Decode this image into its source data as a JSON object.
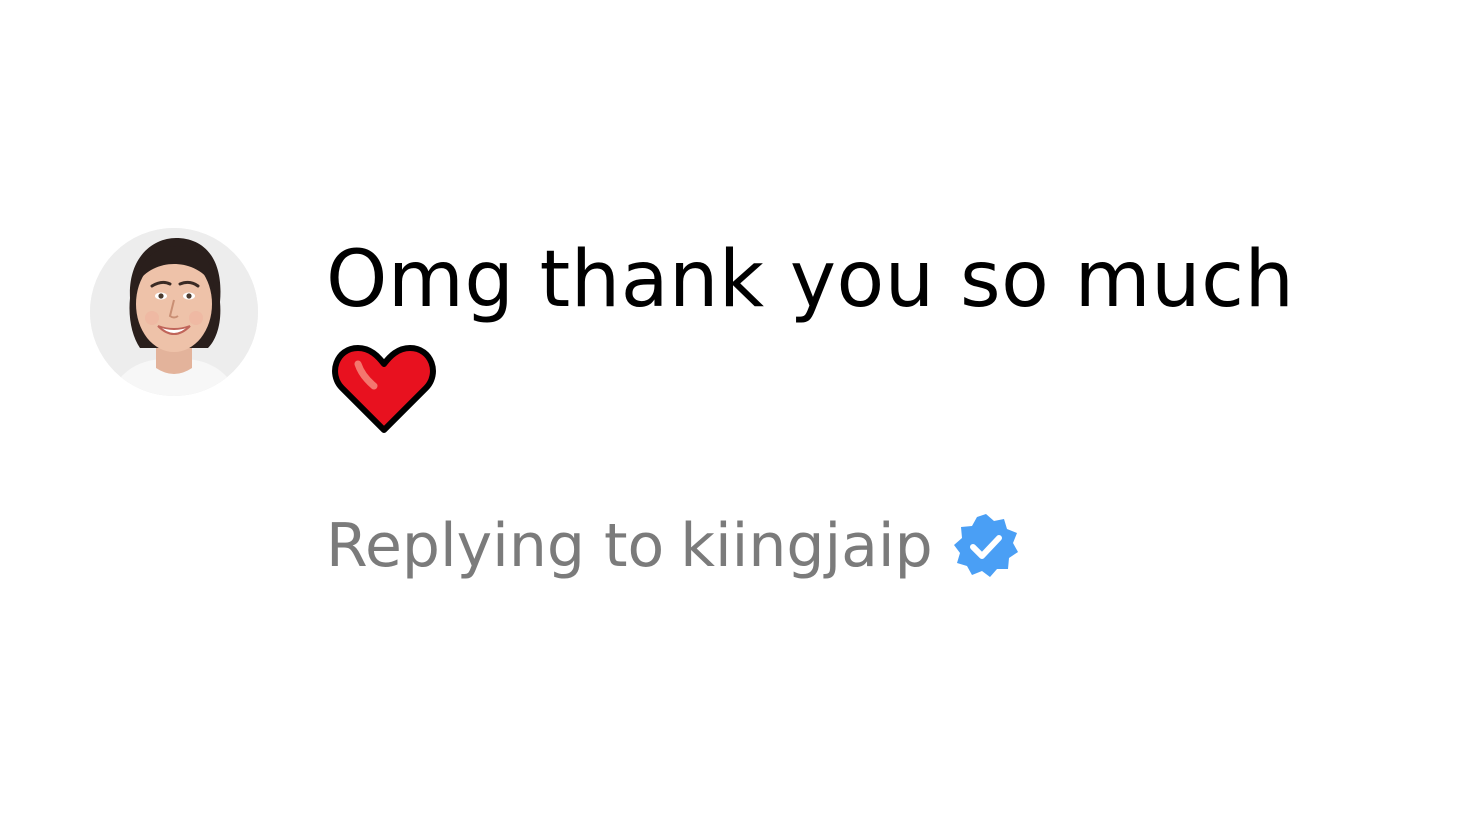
{
  "comment": {
    "text": "Omg thank you so much",
    "emoji": "red-heart",
    "reply_prefix": "Replying to",
    "reply_user": "kiingjaip",
    "verified_badge_color": "#4a9ff5"
  },
  "colors": {
    "text": "#000000",
    "muted": "#7b7b7b",
    "heart": "#e8111f"
  }
}
